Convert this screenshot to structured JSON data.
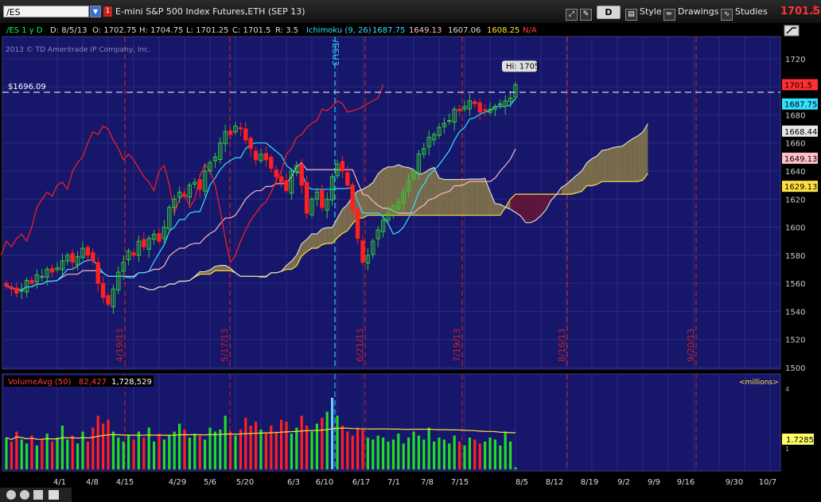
{
  "toolbar": {
    "symbol": "/ES",
    "flag": "1",
    "description": "E-mini S&P 500 Index Futures,ETH (SEP 13)",
    "aggregation": "D",
    "style_label": "Style",
    "drawings_label": "Drawings",
    "studies_label": "Studies",
    "last_price": "1701.50",
    "change_top": "2",
    "change_bottom": "0"
  },
  "header": {
    "symbol": "/ES 1 y D",
    "date": "D: 8/5/13",
    "open": "O: 1702.75",
    "high": "H: 1704.75",
    "low": "L: 1701.25",
    "close": "C: 1701.5",
    "range": "R: 3.5",
    "study": "Ichimoku (9, 26)",
    "ichimoku_values": [
      "1687.75",
      "1649.13",
      "1607.06",
      "1608.25",
      "N/A"
    ],
    "copyright": "2013 © TD Ameritrade IP Company, Inc."
  },
  "volume_header": {
    "study": "VolumeAvg (50)",
    "volume": "82,427",
    "avg": "1,728,529",
    "units": "<millions>"
  },
  "chart_data": {
    "type": "candlestick",
    "ylim": [
      1500,
      1725
    ],
    "yticks": [
      1500,
      1520,
      1540,
      1560,
      1580,
      1600,
      1620,
      1640,
      1660,
      1680,
      1700,
      1720
    ],
    "xticks": [
      "4/1",
      "4/8",
      "4/15",
      "4/29",
      "5/6",
      "5/20",
      "6/3",
      "6/10",
      "6/17",
      "7/1",
      "7/8",
      "7/15",
      "8/5",
      "8/12",
      "8/19",
      "9/2",
      "9/9",
      "9/16",
      "9/30",
      "10/7"
    ],
    "vertical_markers": [
      {
        "label": "4/19/13",
        "type": "red-dashed"
      },
      {
        "label": "5/17/13",
        "type": "red-dashed"
      },
      {
        "label": "6/21/13",
        "type": "red-dashed"
      },
      {
        "label": "7/19/13",
        "type": "red-dashed"
      },
      {
        "label": "8/16/13",
        "type": "red-dashed"
      },
      {
        "label": "9/20/13",
        "type": "red-dashed"
      },
      {
        "label": "/ESU3",
        "type": "cyan-dashed"
      }
    ],
    "price_line": {
      "label": "$1696.09",
      "value": 1696.09
    },
    "high_bubble": "Hi: 1705",
    "axis_badges": [
      {
        "value": "1701.5",
        "color": "#ff3030"
      },
      {
        "value": "1687.75",
        "color": "#33e0ff"
      },
      {
        "value": "1668.44",
        "color": "#e8e8e8"
      },
      {
        "value": "1649.13",
        "color": "#ffc0c8"
      },
      {
        "value": "1629.13",
        "color": "#ffe040"
      }
    ],
    "series": [
      {
        "name": "Close",
        "values": [
          1558,
          1556,
          1553,
          1555,
          1562,
          1560,
          1566,
          1565,
          1570,
          1568,
          1571,
          1576,
          1580,
          1575,
          1579,
          1585,
          1580,
          1576,
          1560,
          1550,
          1545,
          1556,
          1568,
          1575,
          1583,
          1580,
          1590,
          1586,
          1592,
          1595,
          1590,
          1600,
          1614,
          1620,
          1625,
          1622,
          1630,
          1632,
          1627,
          1640,
          1646,
          1650,
          1660,
          1668,
          1666,
          1672,
          1670,
          1662,
          1656,
          1648,
          1652,
          1648,
          1642,
          1636,
          1632,
          1626,
          1640,
          1644,
          1630,
          1610,
          1620,
          1625,
          1614,
          1620,
          1636,
          1645,
          1640,
          1630,
          1612,
          1592,
          1575,
          1580,
          1590,
          1598,
          1605,
          1610,
          1615,
          1618,
          1625,
          1633,
          1640,
          1652,
          1656,
          1664,
          1666,
          1671,
          1674,
          1676,
          1684,
          1683,
          1686,
          1690,
          1688,
          1682,
          1683,
          1684,
          1686,
          1688,
          1690,
          1692,
          1701.5
        ]
      },
      {
        "name": "Volume",
        "values": [
          1.6,
          1.4,
          1.9,
          1.5,
          1.3,
          1.7,
          1.2,
          1.5,
          1.8,
          1.4,
          1.6,
          2.2,
          1.5,
          1.7,
          1.3,
          1.9,
          1.4,
          2.1,
          2.7,
          2.3,
          2.5,
          1.9,
          1.6,
          1.4,
          1.7,
          1.5,
          1.9,
          1.6,
          2.1,
          1.4,
          1.8,
          1.5,
          1.7,
          1.9,
          2.3,
          2.0,
          1.6,
          1.8,
          1.7,
          1.5,
          2.1,
          1.9,
          2.0,
          2.7,
          1.9,
          1.7,
          2.0,
          2.6,
          2.2,
          2.4,
          2.0,
          1.8,
          2.2,
          1.9,
          2.5,
          2.4,
          1.8,
          2.1,
          2.7,
          2.2,
          1.9,
          2.3,
          2.6,
          2.9,
          3.6,
          2.7,
          2.2,
          1.9,
          1.7,
          2.1,
          2.0,
          1.6,
          1.5,
          1.7,
          1.6,
          1.4,
          1.5,
          1.8,
          1.3,
          1.6,
          1.9,
          1.7,
          1.5,
          2.1,
          1.4,
          1.6,
          1.5,
          1.3,
          1.7,
          1.4,
          1.2,
          1.6,
          1.5,
          1.3,
          1.4,
          1.6,
          1.5,
          1.2,
          1.9,
          1.4,
          0.1
        ]
      }
    ]
  }
}
